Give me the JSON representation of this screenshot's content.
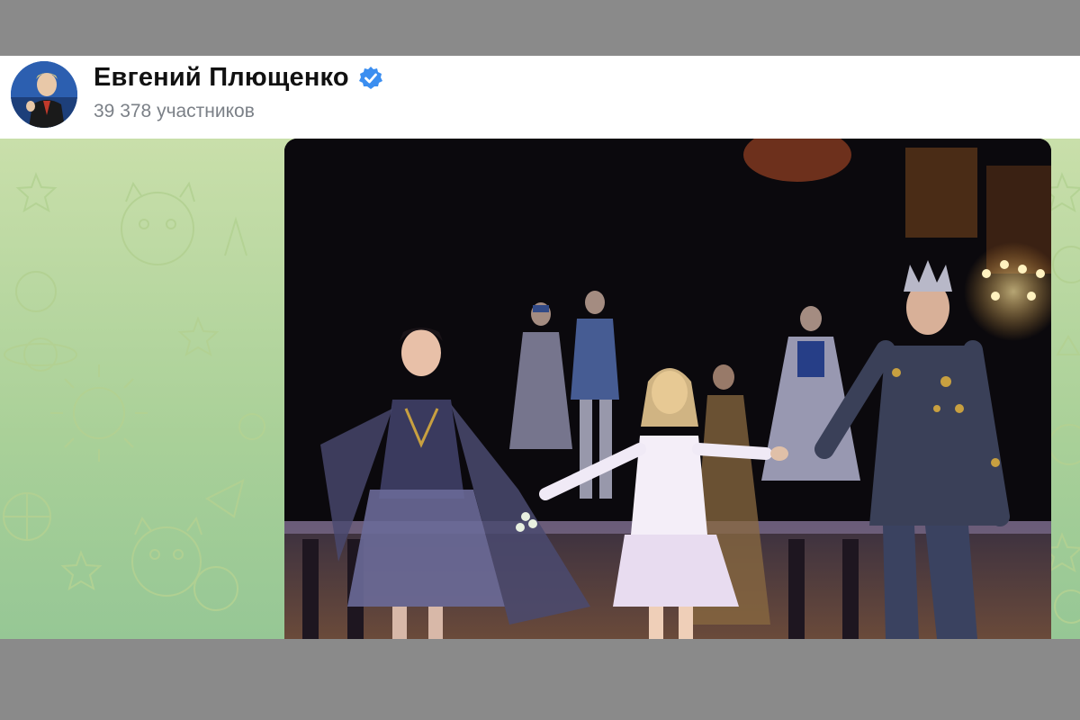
{
  "channel": {
    "name": "Евгений Плющенко",
    "members": "39 378 участников",
    "verified": true
  },
  "icons": {
    "verified": "verified-badge-icon",
    "avatar": "channel-avatar"
  },
  "colors": {
    "header_bg": "#ffffff",
    "verified_blue": "#3b8ef0",
    "chat_bg_top": "#c9dfaa",
    "chat_bg_bottom": "#96c795",
    "frame_gray": "#8a8a8a"
  },
  "message": {
    "type": "photo"
  }
}
